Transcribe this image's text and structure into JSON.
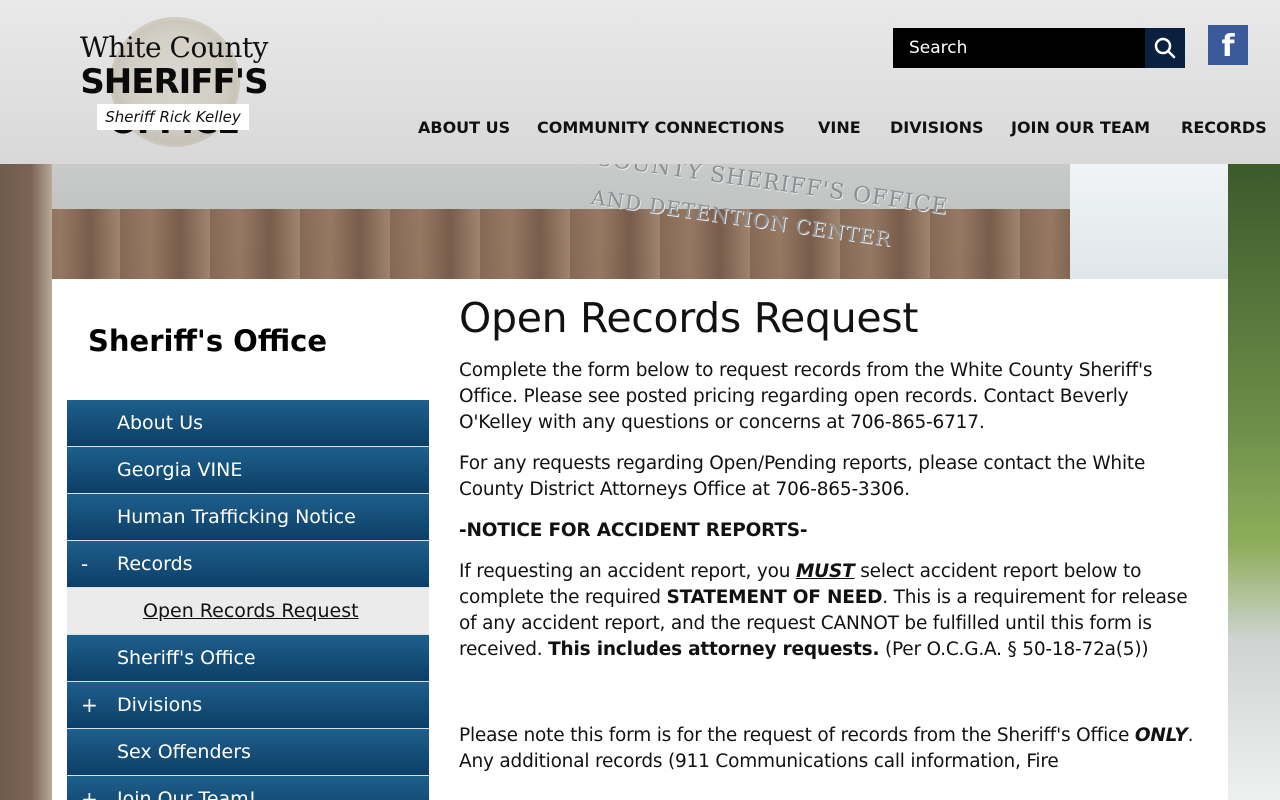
{
  "header": {
    "logo": {
      "line1": "White County",
      "line2": "SHERIFF'S OFFICE",
      "line3": "Sheriff Rick Kelley"
    },
    "search": {
      "placeholder": "Search"
    },
    "social": {
      "facebook_label": "f"
    },
    "nav": [
      {
        "label": "ABOUT US"
      },
      {
        "label": "COMMUNITY CONNECTIONS"
      },
      {
        "label": "VINE"
      },
      {
        "label": "DIVISIONS"
      },
      {
        "label": "JOIN OUR TEAM"
      },
      {
        "label": "RECORDS"
      }
    ]
  },
  "hero": {
    "sign_line1": "WHITE COUNTY SHERIFF'S OFFICE",
    "sign_line2": "AND DETENTION CENTER"
  },
  "sidebar": {
    "title": "Sheriff's Office",
    "items": [
      {
        "label": "About Us",
        "toggle": ""
      },
      {
        "label": "Georgia VINE",
        "toggle": ""
      },
      {
        "label": "Human Trafficking Notice",
        "toggle": ""
      },
      {
        "label": "Records",
        "toggle": "-"
      },
      {
        "label": "Open Records Request"
      },
      {
        "label": "Sheriff's Office",
        "toggle": ""
      },
      {
        "label": "Divisions",
        "toggle": "+"
      },
      {
        "label": "Sex Offenders",
        "toggle": ""
      },
      {
        "label": "Join Our Team!",
        "toggle": "+"
      }
    ]
  },
  "main": {
    "title": "Open Records Request",
    "p1": "Complete the form below to request records from the White County Sheriff's Office. Please see posted pricing regarding open records. Contact Beverly O'Kelley with any questions or concerns at 706-865-6717.",
    "p2": "For any requests regarding Open/Pending reports, please contact the White County District Attorneys Office at 706-865-3306.",
    "notice": "-NOTICE FOR ACCIDENT REPORTS-",
    "p3": {
      "a": "If requesting an accident report, you ",
      "must": "MUST",
      "b": " select accident report below to complete the required ",
      "statement": "STATEMENT OF NEED",
      "c": ". This is a requirement for release of any accident report, and the request CANNOT be fulfilled until this form is received. ",
      "attorney": "This includes attorney requests.",
      "d": " (Per O.C.G.A. § 50-18-72a(5))"
    },
    "p4": {
      "a": "Please note this form is for the request of records from the Sheriff's Office ",
      "only": "ONLY",
      "b": ". Any additional records (911 Communications call information, Fire"
    }
  }
}
